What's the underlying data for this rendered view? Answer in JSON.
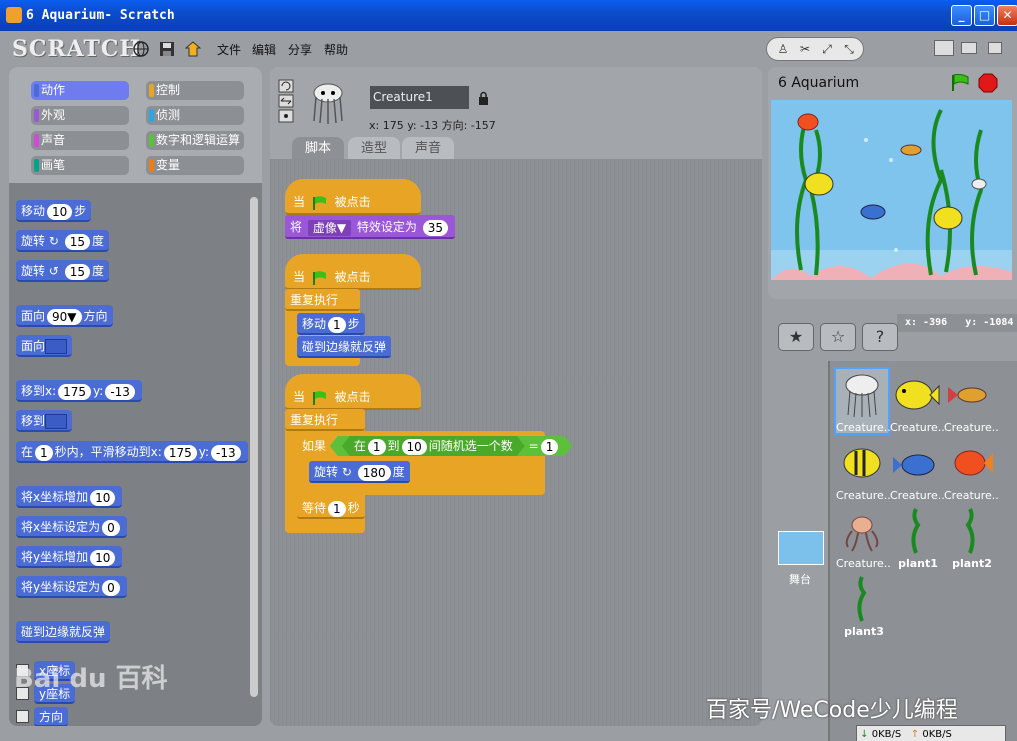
{
  "window": {
    "title": "6 Aquarium- Scratch",
    "minimize": "_",
    "maximize": "□",
    "close": "✕"
  },
  "menu": {
    "logo": "SCRATCH",
    "items": [
      "文件",
      "编辑",
      "分享",
      "帮助"
    ]
  },
  "categories": [
    {
      "label": "动作",
      "color": "#4a6cd4"
    },
    {
      "label": "控制",
      "color": "#e8a525"
    },
    {
      "label": "外观",
      "color": "#9a58d8"
    },
    {
      "label": "侦测",
      "color": "#2ca5e2"
    },
    {
      "label": "声音",
      "color": "#cf4ad9"
    },
    {
      "label": "数字和逻辑运算",
      "color": "#5cc03a"
    },
    {
      "label": "画笔",
      "color": "#00a48a"
    },
    {
      "label": "变量",
      "color": "#ee7d16"
    }
  ],
  "palette": {
    "move_a": "移动",
    "move_val": "10",
    "move_b": "步",
    "turn_a": "旋转",
    "turn_cw_val": "15",
    "turn_ccw_val": "15",
    "turn_b": "度",
    "point_dir_a": "面向",
    "point_dir_val": "90▼",
    "point_dir_b": "方向",
    "point_to": "面向",
    "goto_a": "移到x:",
    "goto_x": "175",
    "goto_y_label": "y:",
    "goto_y": "-13",
    "goto_obj": "移到",
    "glide_a": "在",
    "glide_sec": "1",
    "glide_b": "秒内，平滑移动到x:",
    "glide_x": "175",
    "glide_y_label": "y:",
    "glide_y": "-13",
    "change_x": "将x坐标增加",
    "change_x_val": "10",
    "set_x": "将x坐标设定为",
    "set_x_val": "0",
    "change_y": "将y坐标增加",
    "change_y_val": "10",
    "set_y": "将y坐标设定为",
    "set_y_val": "0",
    "bounce": "碰到边缘就反弹",
    "rep_x": "x座标",
    "rep_y": "y座标",
    "rep_dir": "方向"
  },
  "sprite_info": {
    "name": "Creature1",
    "coords": "x: 175  y: -13   方向: -157"
  },
  "tabs": [
    "脚本",
    "造型",
    "声音"
  ],
  "scripts": {
    "when_a": "当",
    "when_b": "被点击",
    "set_effect_a": "将",
    "set_effect_dd": "虚像▼",
    "set_effect_b": "特效设定为",
    "set_effect_val": "35",
    "forever": "重复执行",
    "move_a": "移动",
    "move_val": "1",
    "move_b": "步",
    "bounce": "碰到边缘就反弹",
    "if": "如果",
    "rand_a": "在",
    "rand_from": "1",
    "rand_to_lbl": "到",
    "rand_to": "10",
    "rand_b": "间随机选一个数",
    "eq": "=",
    "eq_val": "1",
    "turn_a": "旋转",
    "turn_val": "180",
    "turn_b": "度",
    "wait_a": "等待",
    "wait_val": "1",
    "wait_b": "秒"
  },
  "stage": {
    "project_name": "6 Aquarium",
    "mouse_x": "x: -396",
    "mouse_y": "y: -1084"
  },
  "sprites": [
    {
      "name": "Creature...",
      "selected": true
    },
    {
      "name": "Creature...",
      "selected": false
    },
    {
      "name": "Creature...",
      "selected": false
    },
    {
      "name": "Creature...",
      "selected": false
    },
    {
      "name": "Creature...",
      "selected": false
    },
    {
      "name": "Creature...",
      "selected": false
    },
    {
      "name": "Creature...",
      "selected": false
    },
    {
      "name": "plant1",
      "selected": false
    },
    {
      "name": "plant2",
      "selected": false
    },
    {
      "name": "plant3",
      "selected": false
    }
  ],
  "stage_label": "舞台",
  "recorder": {
    "speed": "0KB/S",
    "speed2": "0KB/S"
  },
  "watermarks": {
    "baidu": "Bai du 百科",
    "wecode": "百家号/WeCode少儿编程"
  }
}
